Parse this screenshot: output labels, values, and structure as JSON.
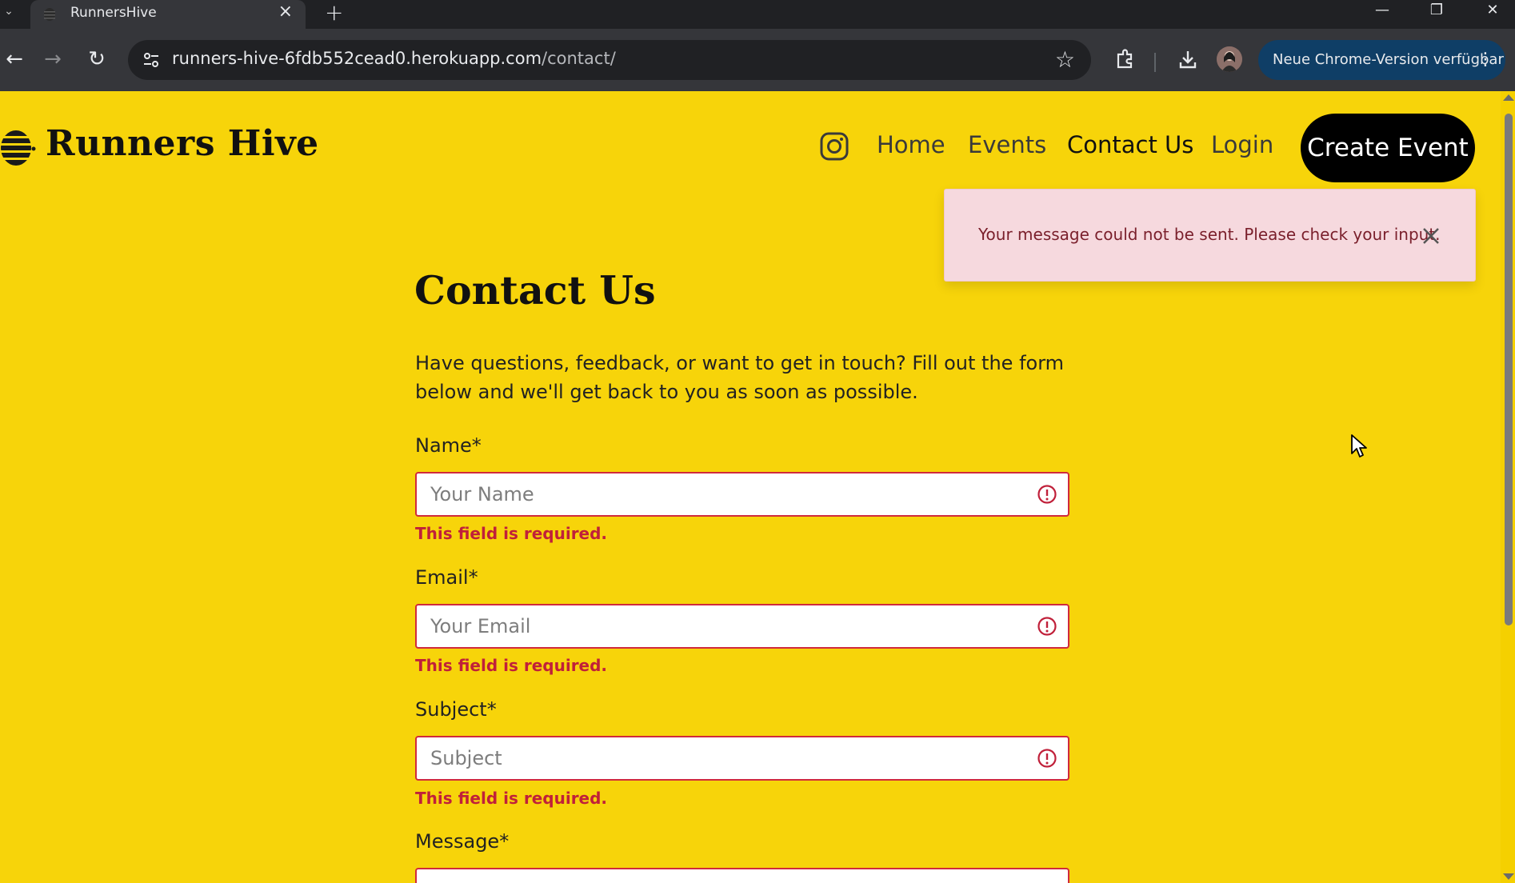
{
  "browser": {
    "tab_title": "RunnersHive",
    "new_tab_label": "+",
    "url_host": "runners-hive-6fdb552cead0.herokuapp.com",
    "url_path": "/contact/",
    "update_button": "Neue Chrome-Version verfügbar"
  },
  "site": {
    "logo_text": "Runners Hive",
    "nav": {
      "home": "Home",
      "events": "Events",
      "contact": "Contact Us",
      "login": "Login"
    },
    "create_event": "Create Event"
  },
  "alert": {
    "message": "Your message could not be sent. Please check your input."
  },
  "contact": {
    "heading": "Contact Us",
    "intro": "Have questions, feedback, or want to get in touch? Fill out the form below and we'll get back to you as soon as possible.",
    "fields": [
      {
        "label": "Name*",
        "placeholder": "Your Name",
        "error": "This field is required."
      },
      {
        "label": "Email*",
        "placeholder": "Your Email",
        "error": "This field is required."
      },
      {
        "label": "Subject*",
        "placeholder": "Subject",
        "error": "This field is required."
      },
      {
        "label": "Message*",
        "placeholder": ""
      }
    ]
  },
  "colors": {
    "page_background": "#f7d40a",
    "error_red": "#c0203a",
    "alert_background": "#f6d9de",
    "button_black": "#000000"
  }
}
